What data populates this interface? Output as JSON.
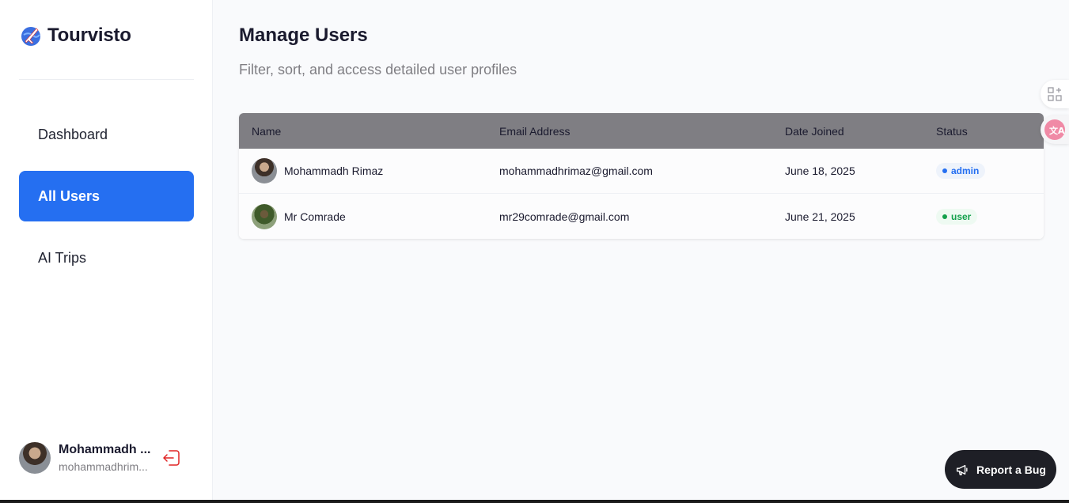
{
  "brand": {
    "title": "Tourvisto"
  },
  "nav": {
    "items": [
      {
        "label": "Dashboard",
        "active": false
      },
      {
        "label": "All Users",
        "active": true
      },
      {
        "label": "AI Trips",
        "active": false
      }
    ]
  },
  "profile": {
    "name": "Mohammadh ...",
    "email": "mohammadhrim..."
  },
  "page": {
    "title": "Manage Users",
    "subtitle": "Filter, sort, and access detailed user profiles"
  },
  "table": {
    "headers": {
      "name": "Name",
      "email": "Email Address",
      "date": "Date Joined",
      "status": "Status"
    },
    "rows": [
      {
        "name": "Mohammadh Rimaz",
        "email": "mohammadhrimaz@gmail.com",
        "date": "June 18, 2025",
        "status": "admin"
      },
      {
        "name": "Mr Comrade",
        "email": "mr29comrade@gmail.com",
        "date": "June 21, 2025",
        "status": "user"
      }
    ]
  },
  "colors": {
    "accent": "#256ff1",
    "header_bg": "#7f7e83",
    "admin_badge": "#256ff1",
    "user_badge": "#12a04b",
    "logout_icon": "#e02424",
    "bug_button_bg": "#1e1f26"
  },
  "icons": {
    "brand": "airplane-globe-icon",
    "logout": "logout-icon",
    "bug": "megaphone-icon",
    "widget_1": "grid-plus-icon",
    "widget_2": "translate-icon"
  },
  "report_bug": {
    "label": "Report a Bug"
  }
}
